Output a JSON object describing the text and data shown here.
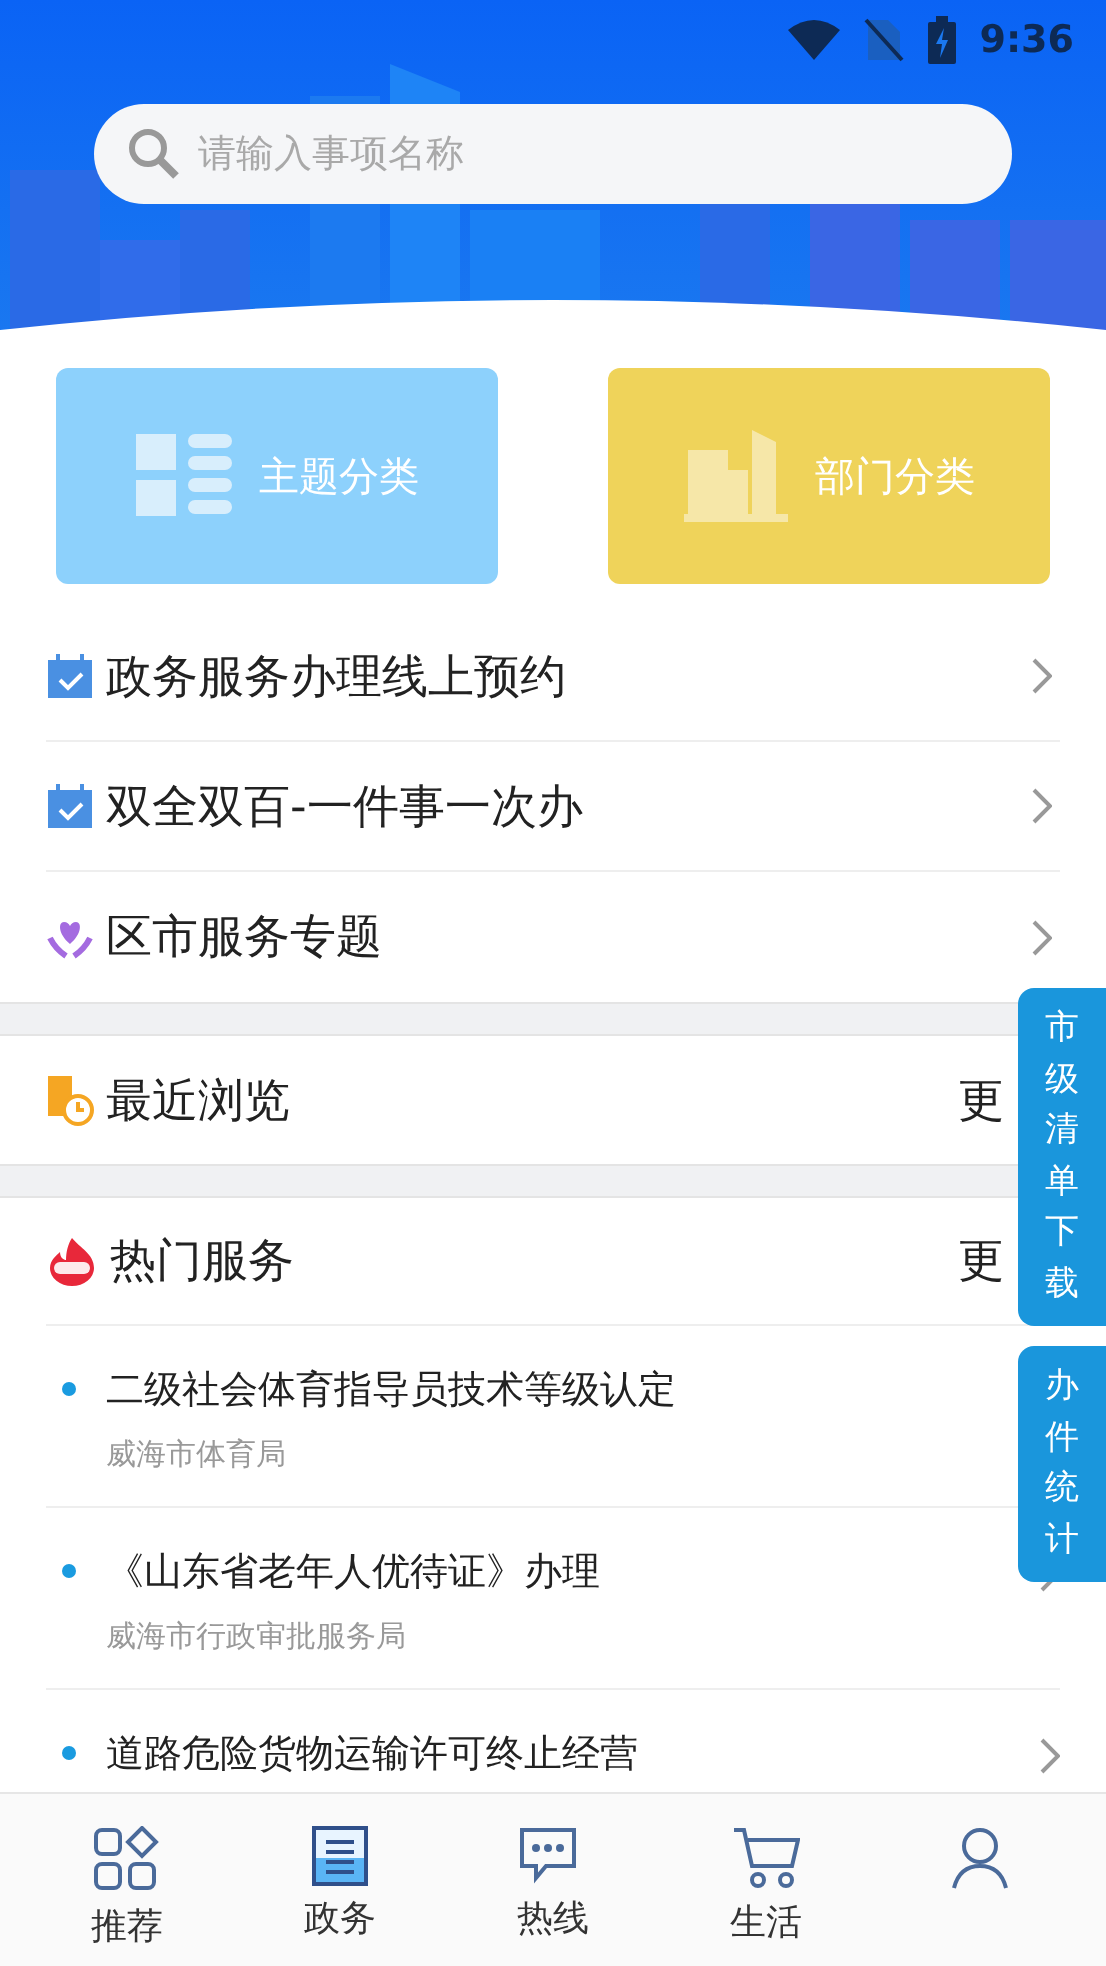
{
  "status_bar": {
    "time": "9:36"
  },
  "search": {
    "placeholder": "请输入事项名称"
  },
  "category_cards": [
    {
      "label": "主题分类",
      "kind": "theme"
    },
    {
      "label": "部门分类",
      "kind": "department"
    }
  ],
  "menu_items": [
    {
      "label": "政务服务办理线上预约",
      "kind": "calendar"
    },
    {
      "label": "双全双百-一件事一次办",
      "kind": "calendar"
    },
    {
      "label": "区市服务专题",
      "kind": "heart"
    }
  ],
  "recent": {
    "title": "最近浏览",
    "more": "更"
  },
  "hot": {
    "title": "热门服务",
    "more": "更",
    "items": [
      {
        "title": "二级社会体育指导员技术等级认定",
        "department": "威海市体育局"
      },
      {
        "title": "《山东省老年人优待证》办理",
        "department": "威海市行政审批服务局",
        "chevron": true
      },
      {
        "title": "道路危险货物运输许可终止经营",
        "chevron": true
      }
    ]
  },
  "side_buttons": [
    "市级清单下载",
    "办件统计"
  ],
  "tabs": [
    {
      "label": "推荐",
      "kind": "grid"
    },
    {
      "label": "政务",
      "kind": "doc"
    },
    {
      "label": "热线",
      "kind": "chat"
    },
    {
      "label": "生活",
      "kind": "cart"
    },
    {
      "kind": "person"
    }
  ]
}
